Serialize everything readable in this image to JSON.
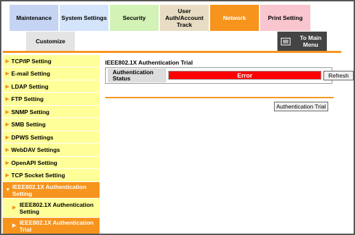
{
  "tabs": {
    "maintenance": "Maintenance",
    "system_settings": "System Settings",
    "security": "Security",
    "user_auth": "User Auth/Account Track",
    "network": "Network",
    "print_setting": "Print Setting",
    "customize": "Customize"
  },
  "to_main_menu": "To Main Menu",
  "sidebar": {
    "items": [
      {
        "label": "TCP/IP Setting"
      },
      {
        "label": "E-mail Setting"
      },
      {
        "label": "LDAP Setting"
      },
      {
        "label": "FTP Setting"
      },
      {
        "label": "SNMP Setting"
      },
      {
        "label": "SMB Setting"
      },
      {
        "label": "DPWS Settings"
      },
      {
        "label": "WebDAV Settings"
      },
      {
        "label": "OpenAPI Setting"
      },
      {
        "label": "TCP Socket Setting"
      },
      {
        "label": "IEEE802.1X Authentication Setting"
      }
    ],
    "subitems": [
      {
        "label": "IEEE802.1X Authentication Setting"
      },
      {
        "label": "IEEE802.1X Authentication Trial"
      }
    ]
  },
  "main": {
    "title": "IEEE802.1X Authentication Trial",
    "status_label": "Authentication Status",
    "status_value": "Error",
    "refresh_label": "Refresh",
    "trial_button": "Authentication Trial"
  },
  "colors": {
    "accent": "#f7941d",
    "sidebar_bg": "#ffff99",
    "error": "#ff0000"
  }
}
